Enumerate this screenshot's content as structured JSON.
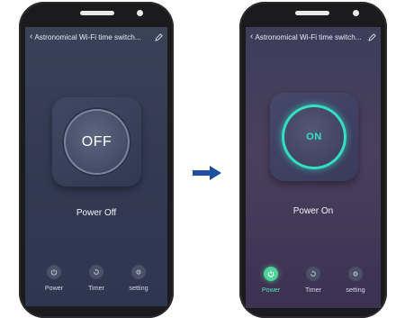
{
  "screen_off": {
    "header_title": "Astronomical Wi-Fi time switch...",
    "switch_label": "OFF",
    "status_text": "Power Off",
    "nav": [
      {
        "label": "Power",
        "icon": "power-icon"
      },
      {
        "label": "Timer",
        "icon": "timer-icon"
      },
      {
        "label": "setting",
        "icon": "gear-icon"
      }
    ]
  },
  "screen_on": {
    "header_title": "Astronomical Wi-Fi time switch...",
    "switch_label": "ON",
    "status_text": "Power On",
    "nav": [
      {
        "label": "Power",
        "icon": "power-icon",
        "active": true
      },
      {
        "label": "Timer",
        "icon": "timer-icon"
      },
      {
        "label": "setting",
        "icon": "gear-icon"
      }
    ]
  },
  "colors": {
    "accent_on": "#35e4c4",
    "nav_active": "#4fd39a",
    "arrow": "#1f4fa3"
  }
}
